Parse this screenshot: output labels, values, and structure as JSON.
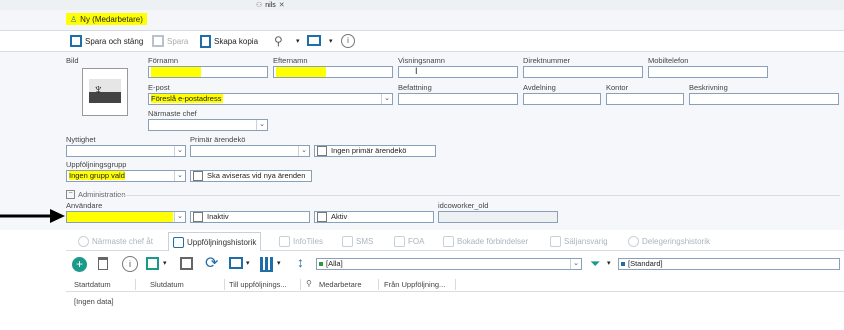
{
  "top_tab": {
    "label": "nils",
    "close": "✕"
  },
  "record_title": "Ny (Medarbetare)",
  "toolbar": {
    "save_close": "Spara och stäng",
    "save": "Spara",
    "copy": "Skapa kopia",
    "info": "i"
  },
  "form": {
    "bild_label": "Bild",
    "fornamn_label": "Förnamn",
    "efternamn_label": "Efternamn",
    "visningsnamn_label": "Visningsnamn",
    "direktnummer_label": "Direktnummer",
    "mobiltelefon_label": "Mobiltelefon",
    "epost_label": "E-post",
    "epost_value": "Föreslå e-postadress",
    "befattning_label": "Befattning",
    "avdelning_label": "Avdelning",
    "kontor_label": "Kontor",
    "beskrivning_label": "Beskrivning",
    "narmaste_chef_label": "Närmaste chef",
    "nyttighet_label": "Nyttighet",
    "primar_arendeko_label": "Primär ärendekö",
    "ingen_primar_label": "Ingen primär ärendekö",
    "uppfoljningsgrupp_label": "Uppföljningsgrupp",
    "uppfoljningsgrupp_value": "Ingen grupp vald",
    "aviseras_label": "Ska aviseras vid nya ärenden",
    "administration_label": "Administration",
    "anvandare_label": "Användare",
    "inaktiv_label": "Inaktiv",
    "aktiv_label": "Aktiv",
    "idcoworker_label": "idcoworker_old"
  },
  "tabs": [
    "Närmaste chef åt",
    "Uppföljningshistorik",
    "InfoTiles",
    "SMS",
    "FOA",
    "Bokade förbindelser",
    "Säljansvarig",
    "Delegeringshistorik"
  ],
  "grid": {
    "filter_value": "[Alla]",
    "view_value": "[Standard]",
    "columns": [
      "Startdatum",
      "Slutdatum",
      "Till uppföljnings...",
      "Medarbetare",
      "Från Uppföljning..."
    ],
    "empty_text": "[Ingen data]"
  },
  "colors": {
    "highlight": "#ffff00",
    "accent": "#1f6ea8",
    "field_border": "#8aa0b8"
  }
}
